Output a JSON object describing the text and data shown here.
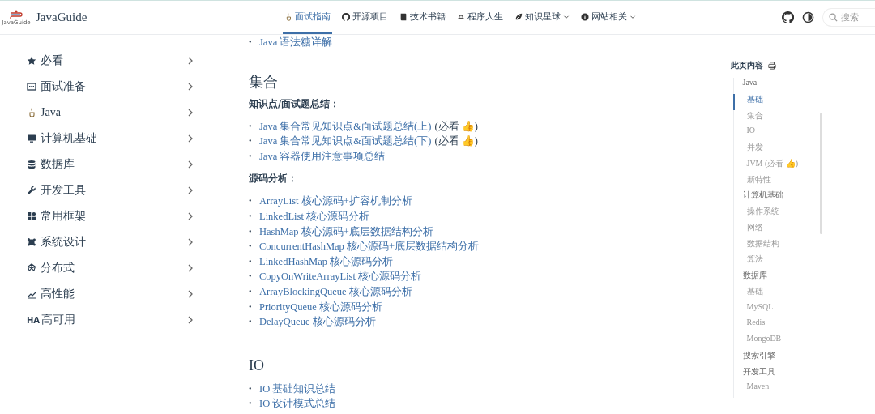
{
  "header": {
    "logo_caption": "JavaGuide",
    "site_title": "JavaGuide",
    "nav": [
      {
        "label": "面试指南",
        "selected": true,
        "dropdown": false
      },
      {
        "label": "开源项目",
        "selected": false,
        "dropdown": false
      },
      {
        "label": "技术书籍",
        "selected": false,
        "dropdown": false
      },
      {
        "label": "程序人生",
        "selected": false,
        "dropdown": false
      },
      {
        "label": "知识星球",
        "selected": false,
        "dropdown": true
      },
      {
        "label": "网站相关",
        "selected": false,
        "dropdown": true
      }
    ],
    "search": {
      "placeholder": "搜索"
    }
  },
  "sidebar": {
    "items": [
      {
        "label": "必看"
      },
      {
        "label": "面试准备"
      },
      {
        "label": "Java"
      },
      {
        "label": "计算机基础"
      },
      {
        "label": "数据库"
      },
      {
        "label": "开发工具"
      },
      {
        "label": "常用框架"
      },
      {
        "label": "系统设计"
      },
      {
        "label": "分布式"
      },
      {
        "label": "高性能"
      },
      {
        "label": "高可用",
        "icon_text": "HA"
      }
    ]
  },
  "article": {
    "blocks": [
      {
        "kind": "list",
        "marker": "•",
        "items": [
          {
            "link": "Java 语法糖详解"
          }
        ]
      },
      {
        "kind": "heading",
        "text": "集合"
      },
      {
        "kind": "label",
        "text": "知识点/面试题总结："
      },
      {
        "kind": "list",
        "marker": "•",
        "items": [
          {
            "link": "Java 集合常见知识点&面试题总结(上)",
            "note": "(必看 👍)"
          },
          {
            "link": "Java 集合常见知识点&面试题总结(下)",
            "note": "(必看 👍)"
          },
          {
            "link": "Java 容器使用注意事项总结"
          }
        ]
      },
      {
        "kind": "label",
        "text": "源码分析："
      },
      {
        "kind": "list",
        "marker": "•",
        "items": [
          {
            "link": "ArrayList 核心源码+扩容机制分析"
          },
          {
            "link": "LinkedList 核心源码分析"
          },
          {
            "link": "HashMap 核心源码+底层数据结构分析"
          },
          {
            "link": "ConcurrentHashMap 核心源码+底层数据结构分析"
          },
          {
            "link": "LinkedHashMap 核心源码分析"
          },
          {
            "link": "CopyOnWriteArrayList 核心源码分析"
          },
          {
            "link": "ArrayBlockingQueue 核心源码分析"
          },
          {
            "link": "PriorityQueue 核心源码分析"
          },
          {
            "link": "DelayQueue 核心源码分析"
          }
        ]
      },
      {
        "kind": "heading",
        "text": "IO"
      },
      {
        "kind": "list",
        "marker": "•",
        "items": [
          {
            "link": "IO 基础知识总结"
          },
          {
            "link": "IO 设计模式总结"
          }
        ]
      }
    ]
  },
  "toc": {
    "title": "此页内容",
    "items": [
      {
        "label": "Java",
        "selected": false,
        "children": [
          {
            "label": "基础",
            "selected": true
          },
          {
            "label": "集合",
            "selected": false
          },
          {
            "label": "IO",
            "selected": false
          },
          {
            "label": "并发",
            "selected": false
          },
          {
            "label": "JVM (必看 👍)",
            "selected": false
          },
          {
            "label": "新特性",
            "selected": false
          }
        ]
      },
      {
        "label": "计算机基础",
        "selected": false,
        "children": [
          {
            "label": "操作系统",
            "selected": false
          },
          {
            "label": "网络",
            "selected": false
          },
          {
            "label": "数据结构",
            "selected": false
          },
          {
            "label": "算法",
            "selected": false
          }
        ]
      },
      {
        "label": "数据库",
        "selected": false,
        "children": [
          {
            "label": "基础",
            "selected": false
          },
          {
            "label": "MySQL",
            "selected": false
          },
          {
            "label": "Redis",
            "selected": false
          },
          {
            "label": "MongoDB",
            "selected": false
          }
        ]
      },
      {
        "label": "搜索引擎",
        "selected": false
      },
      {
        "label": "开发工具",
        "selected": false,
        "children": [
          {
            "label": "Maven",
            "selected": false
          }
        ]
      }
    ]
  }
}
